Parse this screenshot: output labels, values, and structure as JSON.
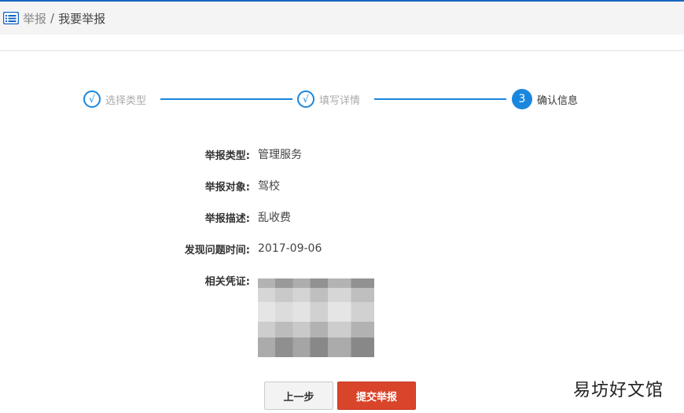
{
  "header": {
    "breadcrumb": [
      "举报",
      "我要举报"
    ],
    "separator": "/",
    "icon": "list-icon",
    "accent": "#1565c0"
  },
  "steps": [
    {
      "marker": "√",
      "label": "选择类型",
      "state": "done"
    },
    {
      "marker": "√",
      "label": "填写详情",
      "state": "done"
    },
    {
      "marker": "3",
      "label": "确认信息",
      "state": "active"
    }
  ],
  "details": [
    {
      "key": "举报类型:",
      "value": "管理服务"
    },
    {
      "key": "举报对象:",
      "value": "驾校"
    },
    {
      "key": "举报描述:",
      "value": "乱收费"
    },
    {
      "key": "发现问题时间:",
      "value": "2017-09-06"
    },
    {
      "key": "相关凭证:",
      "value": ""
    }
  ],
  "buttons": {
    "prev": "上一步",
    "submit": "提交举报",
    "submit_color": "#d9452b"
  },
  "watermark": "易坊好文馆"
}
